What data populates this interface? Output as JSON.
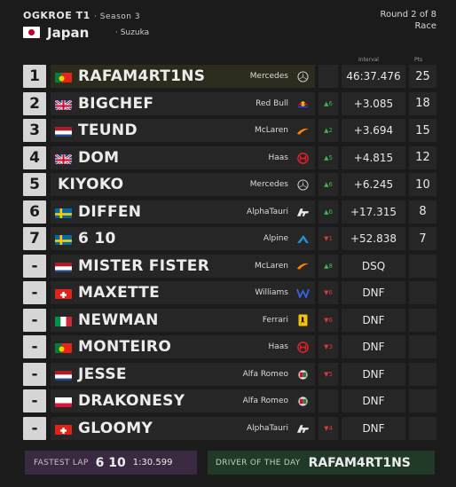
{
  "header": {
    "series": "OGKROE T1",
    "season": "· Season 3",
    "country": "Japan",
    "circuit": "· Suzuka",
    "round": "Round 2 of 8",
    "session": "Race"
  },
  "columns": {
    "interval": "Interval",
    "pts": "Pts"
  },
  "rows": [
    {
      "pos": "1",
      "flag": "pt",
      "name": "RAFAM4RT1NS",
      "team": "Mercedes",
      "logo": "mercedes-icon",
      "gain": "",
      "gain_dir": "",
      "interval": "46:37.476",
      "pts": "25"
    },
    {
      "pos": "2",
      "flag": "gb",
      "name": "BIGCHEF",
      "team": "Red Bull",
      "logo": "redbull-icon",
      "gain": "▲6",
      "gain_dir": "up",
      "interval": "+3.085",
      "pts": "18"
    },
    {
      "pos": "3",
      "flag": "nl",
      "name": "TEUND",
      "team": "McLaren",
      "logo": "mclaren-icon",
      "gain": "▲2",
      "gain_dir": "up",
      "interval": "+3.694",
      "pts": "15"
    },
    {
      "pos": "4",
      "flag": "gb",
      "name": "DOM",
      "team": "Haas",
      "logo": "haas-icon",
      "gain": "▲5",
      "gain_dir": "up",
      "interval": "+4.815",
      "pts": "12"
    },
    {
      "pos": "5",
      "flag": "",
      "name": "KIYOKO",
      "team": "Mercedes",
      "logo": "mercedes-icon",
      "gain": "▲6",
      "gain_dir": "up",
      "interval": "+6.245",
      "pts": "10"
    },
    {
      "pos": "6",
      "flag": "se",
      "name": "DIFFEN",
      "team": "AlphaTauri",
      "logo": "alphatauri-icon",
      "gain": "▲6",
      "gain_dir": "up",
      "interval": "+17.315",
      "pts": "8"
    },
    {
      "pos": "7",
      "flag": "se",
      "name": "6 10",
      "team": "Alpine",
      "logo": "alpine-icon",
      "gain": "▼1",
      "gain_dir": "down",
      "interval": "+52.838",
      "pts": "7"
    },
    {
      "pos": "-",
      "flag": "nl",
      "name": "MISTER FISTER",
      "team": "McLaren",
      "logo": "mclaren-icon",
      "gain": "▲8",
      "gain_dir": "up",
      "interval": "DSQ",
      "pts": ""
    },
    {
      "pos": "-",
      "flag": "ch",
      "name": "MAXETTE",
      "team": "Williams",
      "logo": "williams-icon",
      "gain": "▼6",
      "gain_dir": "down",
      "interval": "DNF",
      "pts": ""
    },
    {
      "pos": "-",
      "flag": "it",
      "name": "NEWMAN",
      "team": "Ferrari",
      "logo": "ferrari-icon",
      "gain": "▼6",
      "gain_dir": "down",
      "interval": "DNF",
      "pts": ""
    },
    {
      "pos": "-",
      "flag": "pt",
      "name": "MONTEIRO",
      "team": "Haas",
      "logo": "haas-icon",
      "gain": "▼3",
      "gain_dir": "down",
      "interval": "DNF",
      "pts": ""
    },
    {
      "pos": "-",
      "flag": "nl",
      "name": "JESSE",
      "team": "Alfa Romeo",
      "logo": "alfaromeo-icon",
      "gain": "▼5",
      "gain_dir": "down",
      "interval": "DNF",
      "pts": ""
    },
    {
      "pos": "-",
      "flag": "pl",
      "name": "DRAKONESY",
      "team": "Alfa Romeo",
      "logo": "alfaromeo-icon",
      "gain": "",
      "gain_dir": "",
      "interval": "DNF",
      "pts": ""
    },
    {
      "pos": "-",
      "flag": "ch",
      "name": "GLOOMY",
      "team": "AlphaTauri",
      "logo": "alphatauri-icon",
      "gain": "▼4",
      "gain_dir": "down",
      "interval": "DNF",
      "pts": ""
    }
  ],
  "footer": {
    "fastest_lap_label": "FASTEST LAP",
    "fastest_lap_driver": "6 10",
    "fastest_lap_time": "1:30.599",
    "dotd_label": "DRIVER OF THE DAY",
    "dotd_driver": "RAFAM4RT1NS"
  },
  "colors": {
    "background": "#1b1b1b",
    "row": "#262626",
    "leader_row": "#2c2b1e",
    "fastest_lap_bg": "#3a2a41",
    "dotd_bg": "#213a27",
    "gain_up": "#3fb34f",
    "gain_down": "#d23b3b"
  }
}
